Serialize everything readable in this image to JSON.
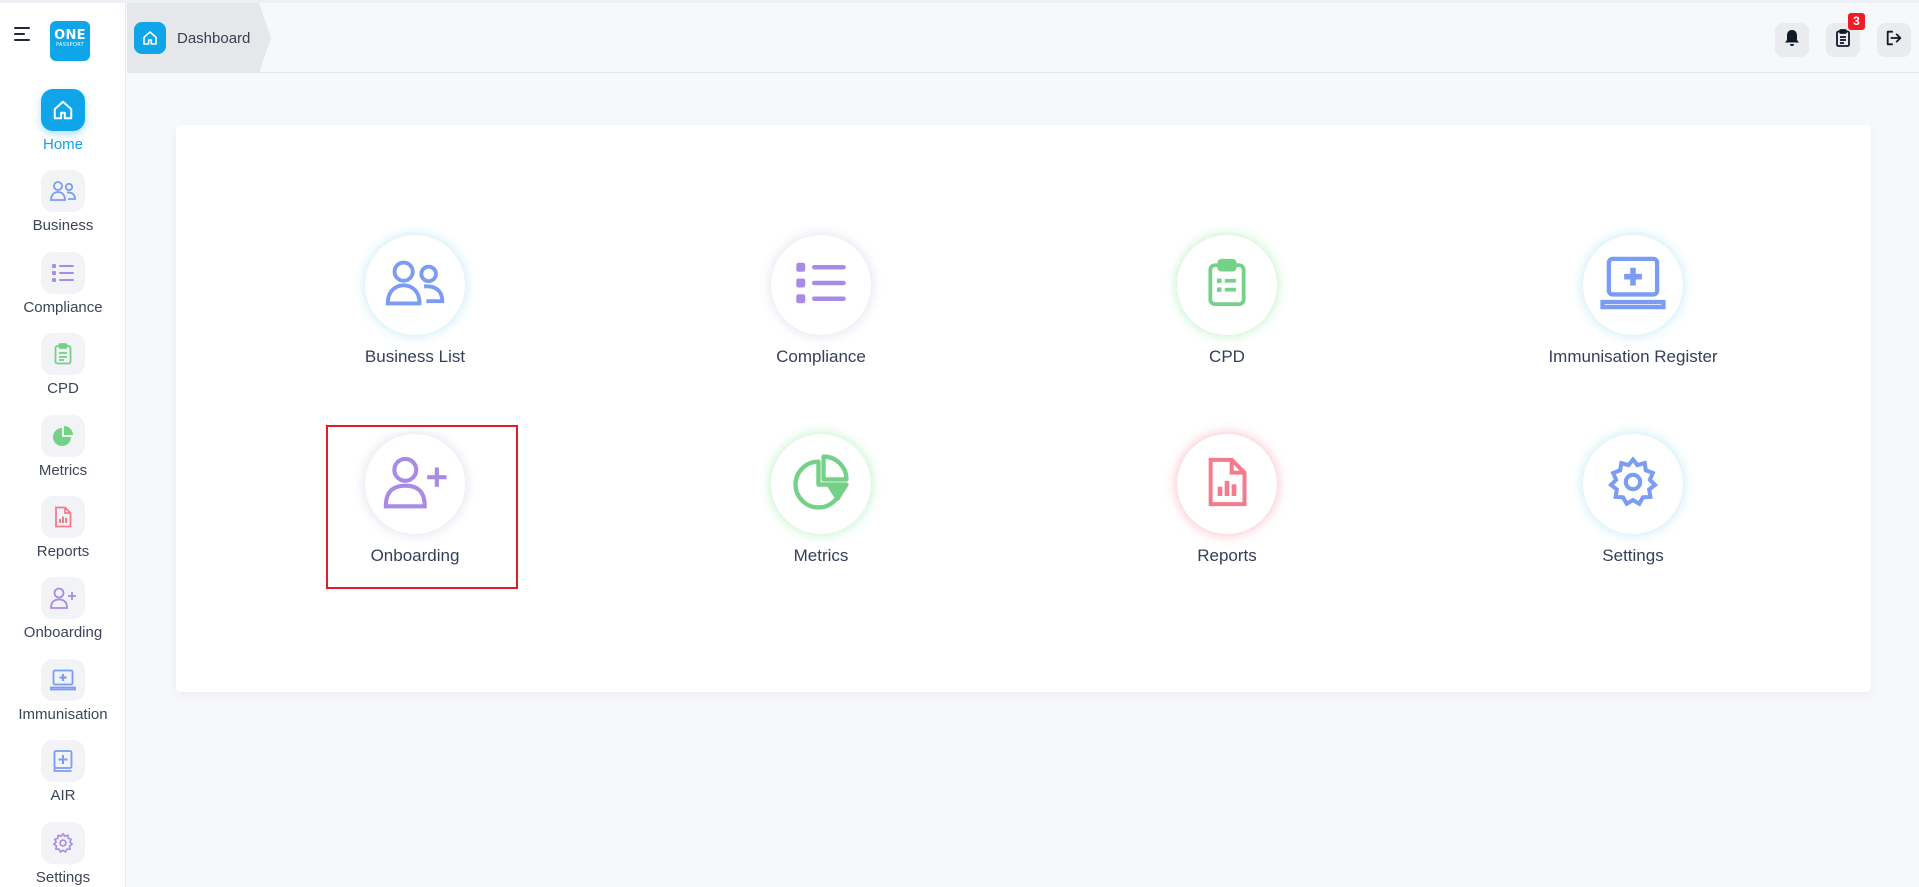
{
  "app": {
    "logo_line1": "ONE",
    "logo_line2": "PASSPORT",
    "accent_color": "#0ea5e9"
  },
  "sidebar": {
    "items": [
      {
        "label": "Home",
        "icon": "home-icon",
        "active": true
      },
      {
        "label": "Business",
        "icon": "users-icon"
      },
      {
        "label": "Compliance",
        "icon": "list-icon"
      },
      {
        "label": "CPD",
        "icon": "clipboard-icon"
      },
      {
        "label": "Metrics",
        "icon": "pie-chart-icon"
      },
      {
        "label": "Reports",
        "icon": "report-file-icon"
      },
      {
        "label": "Onboarding",
        "icon": "user-plus-icon"
      },
      {
        "label": "Immunisation",
        "icon": "laptop-medical-icon"
      },
      {
        "label": "AIR",
        "icon": "medical-book-icon"
      },
      {
        "label": "Settings",
        "icon": "gear-icon"
      }
    ]
  },
  "header": {
    "breadcrumb": "Dashboard",
    "notification_count": "3"
  },
  "dashboard": {
    "tiles": [
      {
        "label": "Business List",
        "icon": "users-icon",
        "color": "#7b9cf3"
      },
      {
        "label": "Compliance",
        "icon": "list-icon",
        "color": "#a98be6"
      },
      {
        "label": "CPD",
        "icon": "clipboard-icon",
        "color": "#74d187"
      },
      {
        "label": "Immunisation Register",
        "icon": "laptop-medical-icon",
        "color": "#7b9cf3"
      },
      {
        "label": "Onboarding",
        "icon": "user-plus-icon",
        "color": "#a98be6"
      },
      {
        "label": "Metrics",
        "icon": "pie-chart-icon",
        "color": "#74d187"
      },
      {
        "label": "Reports",
        "icon": "report-file-icon",
        "color": "#f47b8c"
      },
      {
        "label": "Settings",
        "icon": "gear-icon",
        "color": "#7b9cf3"
      }
    ]
  }
}
